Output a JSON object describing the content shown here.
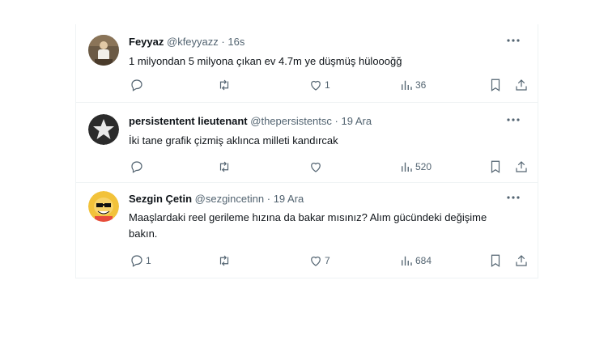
{
  "tweets": [
    {
      "name": "Feyyaz",
      "handle": "@kfeyyazz",
      "sep": "·",
      "time": "16s",
      "text": "1 milyondan 5 milyona çıkan ev 4.7m ye düşmüş hüloooğğ",
      "replies": "",
      "retweets": "",
      "likes": "1",
      "views": "36"
    },
    {
      "name": "persistentent lieutenant",
      "handle": "@thepersistentsc",
      "sep": "·",
      "time": "19 Ara",
      "text": "İki tane grafik çizmiş aklınca milleti kandırcak",
      "replies": "",
      "retweets": "",
      "likes": "",
      "views": "520"
    },
    {
      "name": "Sezgin Çetin",
      "handle": "@sezgincetinn",
      "sep": "·",
      "time": "19 Ara",
      "text": "Maaşlardaki reel gerileme hızına da bakar mısınız? Alım gücündeki değişime bakın.",
      "replies": "1",
      "retweets": "",
      "likes": "7",
      "views": "684"
    }
  ],
  "icons": {
    "more": "more-icon",
    "reply": "reply-icon",
    "retweet": "retweet-icon",
    "like": "heart-icon",
    "views": "views-icon",
    "bookmark": "bookmark-icon",
    "share": "share-icon"
  },
  "colors": {
    "text": "#0f1419",
    "secondary": "#536471",
    "border": "#eff3f4"
  }
}
